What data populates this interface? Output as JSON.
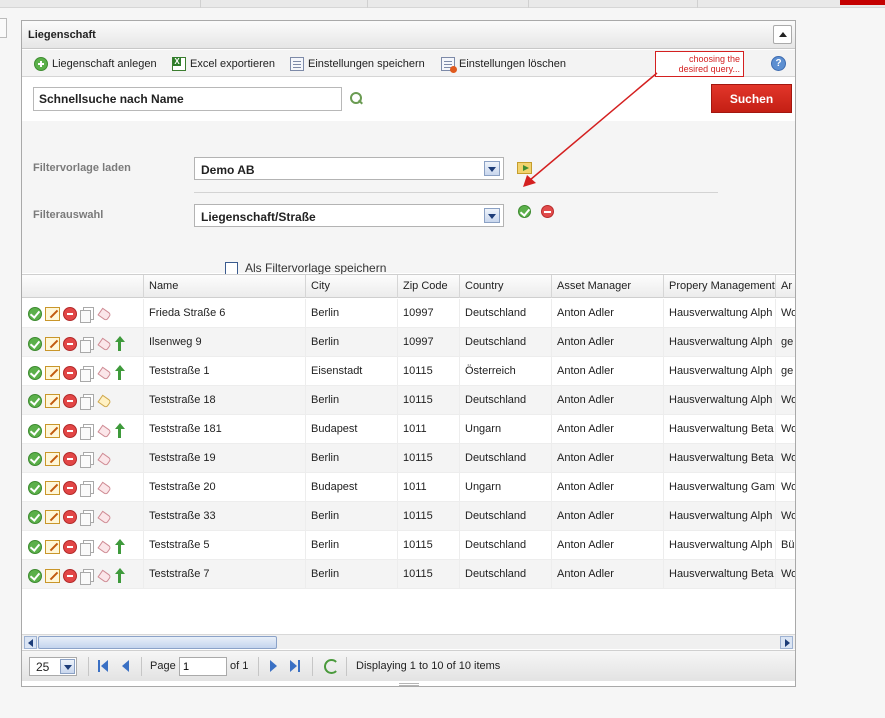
{
  "panel": {
    "title": "Liegenschaft"
  },
  "toolbar": {
    "items": [
      {
        "label": "Liegenschaft anlegen",
        "icon": "add-circle-icon"
      },
      {
        "label": "Excel exportieren",
        "icon": "excel-icon"
      },
      {
        "label": "Einstellungen speichern",
        "icon": "save-settings-icon"
      },
      {
        "label": "Einstellungen löschen",
        "icon": "delete-settings-icon"
      }
    ],
    "help_label": "?"
  },
  "search": {
    "value": "Schnellsuche nach Name",
    "button_label": "Suchen"
  },
  "filters": {
    "template_label": "Filtervorlage laden",
    "template_value": "Demo AB",
    "selection_label": "Filterauswahl",
    "selection_value": "Liegenschaft/Straße",
    "save_template_label": "Als Filtervorlage speichern"
  },
  "annotation": {
    "text": "choosing the desired query..."
  },
  "grid": {
    "columns": [
      "Name",
      "City",
      "Zip Code",
      "Country",
      "Asset Manager",
      "Propery Management",
      "Ar"
    ],
    "rows": [
      {
        "name": "Frieda Straße 6",
        "city": "Berlin",
        "zip": "10997",
        "country": "Deutschland",
        "asset_manager": "Anton Adler",
        "property_management": "Hausverwaltung Alph",
        "extra": "Wo",
        "arrow": false,
        "tag": "pink"
      },
      {
        "name": "Ilsenweg 9",
        "city": "Berlin",
        "zip": "10997",
        "country": "Deutschland",
        "asset_manager": "Anton Adler",
        "property_management": "Hausverwaltung Alph",
        "extra": "ge",
        "arrow": true,
        "tag": "pink"
      },
      {
        "name": "Teststraße 1",
        "city": "Eisenstadt",
        "zip": "10115",
        "country": "Österreich",
        "asset_manager": "Anton Adler",
        "property_management": "Hausverwaltung Alph",
        "extra": "ge",
        "arrow": true,
        "tag": "pink"
      },
      {
        "name": "Teststraße 18",
        "city": "Berlin",
        "zip": "10115",
        "country": "Deutschland",
        "asset_manager": "Anton Adler",
        "property_management": "Hausverwaltung Alph",
        "extra": "Wo",
        "arrow": false,
        "tag": "yellow"
      },
      {
        "name": "Teststraße 181",
        "city": "Budapest",
        "zip": "1011",
        "country": "Ungarn",
        "asset_manager": "Anton Adler",
        "property_management": "Hausverwaltung Beta",
        "extra": "Wo",
        "arrow": true,
        "tag": "pink"
      },
      {
        "name": "Teststraße 19",
        "city": "Berlin",
        "zip": "10115",
        "country": "Deutschland",
        "asset_manager": "Anton Adler",
        "property_management": "Hausverwaltung Beta",
        "extra": "Wo",
        "arrow": false,
        "tag": "pink"
      },
      {
        "name": "Teststraße 20",
        "city": "Budapest",
        "zip": "1011",
        "country": "Ungarn",
        "asset_manager": "Anton Adler",
        "property_management": "Hausverwaltung Gam",
        "extra": "Wo",
        "arrow": false,
        "tag": "pink"
      },
      {
        "name": "Teststraße 33",
        "city": "Berlin",
        "zip": "10115",
        "country": "Deutschland",
        "asset_manager": "Anton Adler",
        "property_management": "Hausverwaltung Alph",
        "extra": "Wo",
        "arrow": false,
        "tag": "pink"
      },
      {
        "name": "Teststraße 5",
        "city": "Berlin",
        "zip": "10115",
        "country": "Deutschland",
        "asset_manager": "Anton Adler",
        "property_management": "Hausverwaltung Alph",
        "extra": "Bü",
        "arrow": true,
        "tag": "pink"
      },
      {
        "name": "Teststraße 7",
        "city": "Berlin",
        "zip": "10115",
        "country": "Deutschland",
        "asset_manager": "Anton Adler",
        "property_management": "Hausverwaltung Beta",
        "extra": "Wo",
        "arrow": true,
        "tag": "pink"
      }
    ]
  },
  "pager": {
    "page_size": "25",
    "page_label": "Page",
    "page_value": "1",
    "of_label": "of 1",
    "status": "Displaying 1 to 10 of 10 items"
  },
  "colors": {
    "accent_red": "#d42020",
    "search_button": "#d22a1f",
    "link_blue": "#3a70c4"
  }
}
